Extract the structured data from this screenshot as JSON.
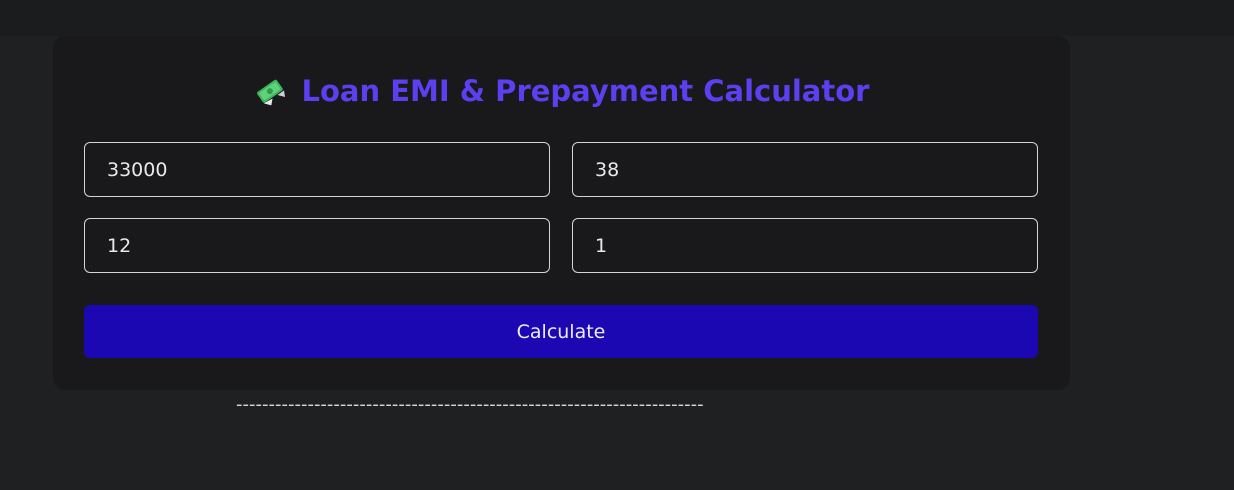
{
  "header": {
    "title": "Loan EMI & Prepayment Calculator",
    "icon": "money-with-wings-icon"
  },
  "form": {
    "loan_amount": "33000",
    "interest_rate": "38",
    "tenure": "12",
    "prepayment": "1"
  },
  "actions": {
    "calculate_label": "Calculate"
  },
  "result": {
    "divider_text": "------------------------------------------------------------------------"
  },
  "colors": {
    "accent": "#5b3ff1",
    "button": "#1c08b2",
    "background": "#1f2022",
    "card": "#19191b"
  }
}
